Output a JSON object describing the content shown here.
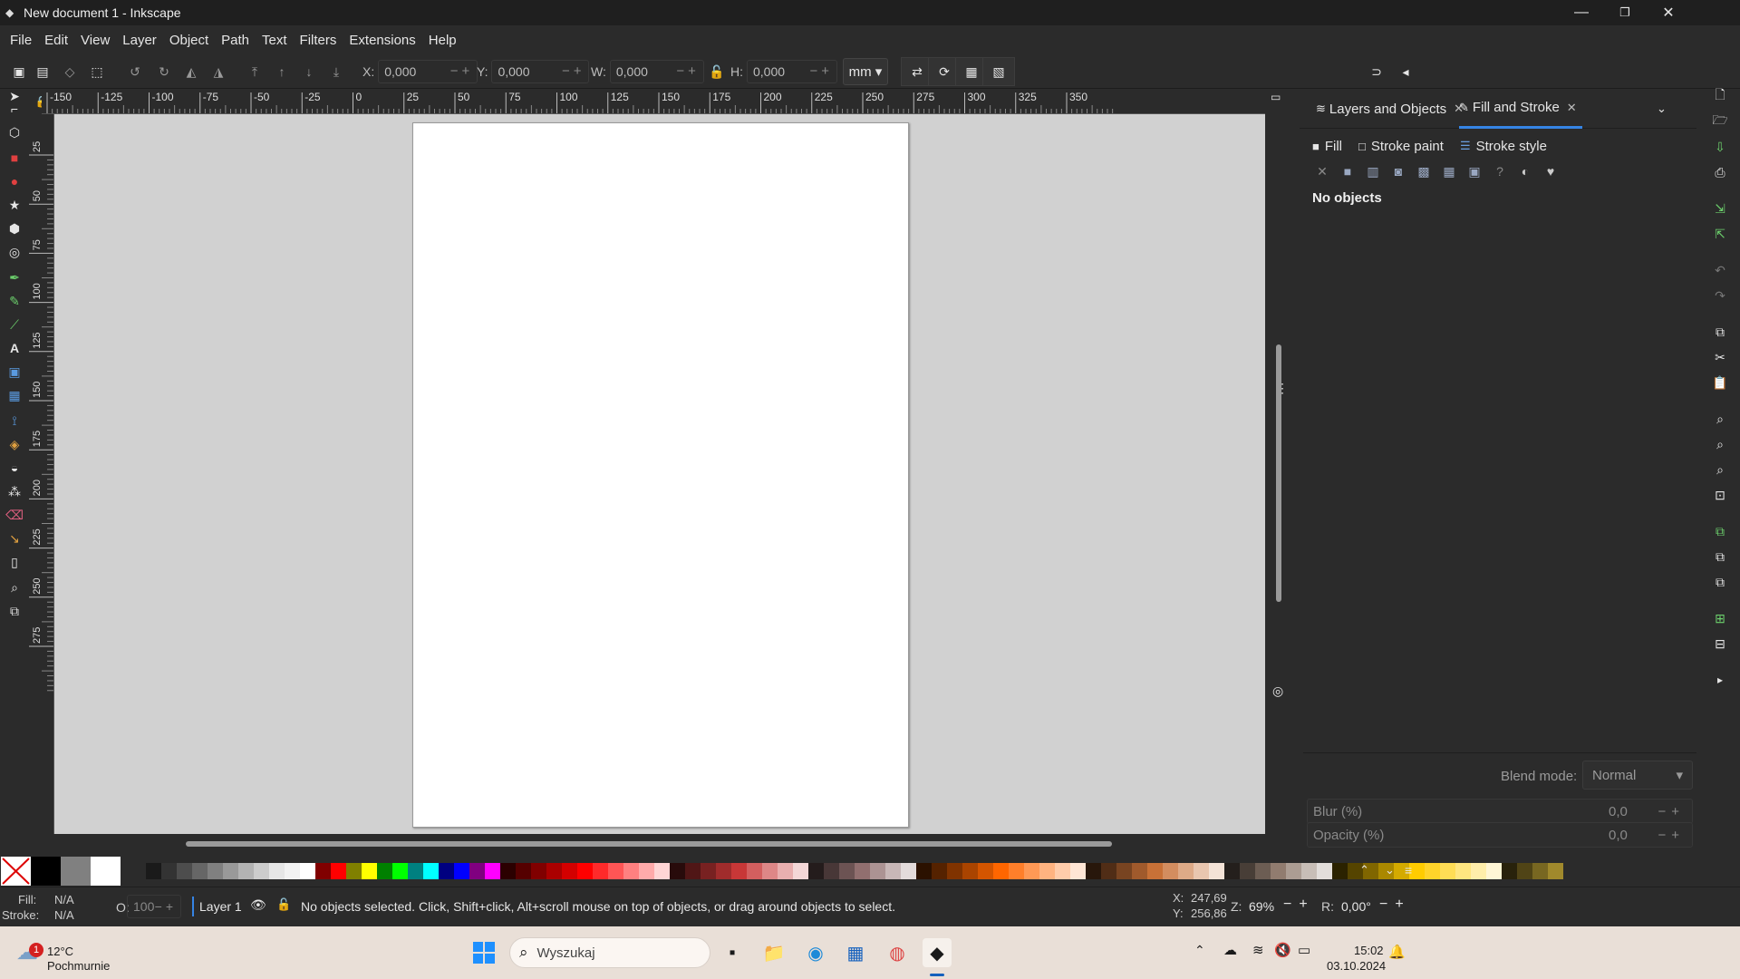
{
  "window": {
    "title": "New document 1 - Inkscape"
  },
  "menu": [
    "File",
    "Edit",
    "View",
    "Layer",
    "Object",
    "Path",
    "Text",
    "Filters",
    "Extensions",
    "Help"
  ],
  "toolbar": {
    "x_label": "X:",
    "x_value": "0,000",
    "y_label": "Y:",
    "y_value": "0,000",
    "w_label": "W:",
    "w_value": "0,000",
    "h_label": "H:",
    "h_value": "0,000",
    "unit": "mm"
  },
  "ruler": {
    "h_ticks": [
      "-150",
      "-125",
      "-100",
      "-75",
      "-50",
      "-25",
      "0",
      "25",
      "50",
      "75",
      "100",
      "125",
      "150",
      "175",
      "200",
      "225",
      "250",
      "275",
      "300",
      "325",
      "350"
    ],
    "v_ticks": [
      "25",
      "50",
      "75",
      "100",
      "125",
      "150",
      "175",
      "200",
      "225",
      "250",
      "275"
    ]
  },
  "panel": {
    "tabs": [
      {
        "label": "Layers and Objects"
      },
      {
        "label": "Fill and Stroke"
      }
    ],
    "subtabs": [
      {
        "label": "Fill"
      },
      {
        "label": "Stroke paint"
      },
      {
        "label": "Stroke style"
      }
    ],
    "message": "No objects",
    "blend_label": "Blend mode:",
    "blend_value": "Normal",
    "blur_label": "Blur (%)",
    "blur_value": "0,0",
    "opacity_label": "Opacity (%)",
    "opacity_value": "0,0"
  },
  "status": {
    "fill_label": "Fill:",
    "fill_value": "N/A",
    "stroke_label": "Stroke:",
    "stroke_value": "N/A",
    "opacity_label": "O:",
    "opacity_value": "100",
    "layer": "Layer 1",
    "message": "No objects selected. Click, Shift+click, Alt+scroll mouse on top of objects, or drag around objects to select.",
    "x_label": "X:",
    "x_value": "247,69",
    "y_label": "Y:",
    "y_value": "256,86",
    "zoom_label": "Z:",
    "zoom_value": "69%",
    "rotate_label": "R:",
    "rotate_value": "0,00°"
  },
  "taskbar": {
    "weather_temp": "12°C",
    "weather_desc": "Pochmurnie",
    "weather_badge": "1",
    "search_placeholder": "Wyszukaj",
    "time": "15:02",
    "date": "03.10.2024"
  },
  "palette_colors": [
    "#000000",
    "#808080",
    "#ffffff",
    "#1a1a1a",
    "#333333",
    "#4d4d4d",
    "#666666",
    "#808080",
    "#999999",
    "#b3b3b3",
    "#cccccc",
    "#e6e6e6",
    "#f2f2f2",
    "#ffffff",
    "#800000",
    "#ff0000",
    "#808000",
    "#ffff00",
    "#008000",
    "#00ff00",
    "#008080",
    "#00ffff",
    "#000080",
    "#0000ff",
    "#800080",
    "#ff00ff",
    "#2b0000",
    "#550000",
    "#800000",
    "#aa0000",
    "#d40000",
    "#ff0000",
    "#ff2a2a",
    "#ff5555",
    "#ff8080",
    "#ffaaaa",
    "#ffd5d5",
    "#280b0b",
    "#501616",
    "#782121",
    "#a02c2c",
    "#c83737",
    "#d35f5f",
    "#de8787",
    "#e9afaf",
    "#f4d7d7",
    "#241c1c",
    "#483737",
    "#6c5353",
    "#916f6f",
    "#ac9393",
    "#c8b7b7",
    "#e3dbdb",
    "#2b1100",
    "#552200",
    "#803300",
    "#aa4400",
    "#d45500",
    "#ff6600",
    "#ff7f2a",
    "#ff9955",
    "#ffb380",
    "#ffccaa",
    "#ffe6d5",
    "#28170b",
    "#502d16",
    "#784421",
    "#a05a2c",
    "#c87137",
    "#d38d5f",
    "#deaa87",
    "#e9c6af",
    "#f4e3d7",
    "#241f1c",
    "#483e37",
    "#6c5d53",
    "#917c6f",
    "#ac9d93",
    "#c8beb7",
    "#e3dedb",
    "#2b2200",
    "#554400",
    "#806600",
    "#aa8800",
    "#d4aa00",
    "#ffcc00",
    "#ffd42a",
    "#ffdd55",
    "#ffe680",
    "#ffeeaa",
    "#fff6d5",
    "#28220b",
    "#504416",
    "#786721",
    "#a0892c"
  ]
}
